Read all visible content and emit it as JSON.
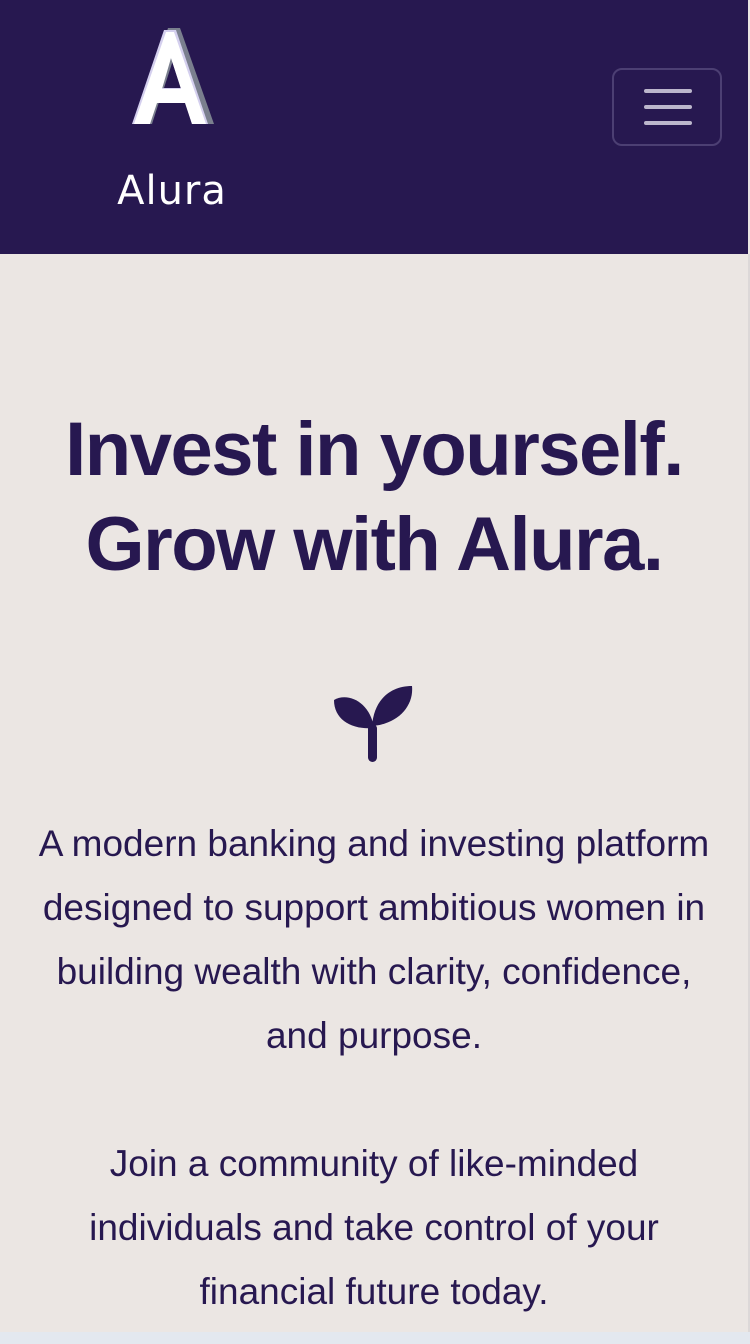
{
  "header": {
    "logo_text": "Alura",
    "menu_icon": "hamburger-icon"
  },
  "hero": {
    "title_line1": "Invest in yourself.",
    "title_line2": "Grow with Alura.",
    "icon": "sprout-icon",
    "paragraph1": "A modern banking and investing platform designed to support ambitious women in building wealth with clarity, confidence, and purpose.",
    "paragraph2": "Join a community of like-minded individuals and take control of your financial future today."
  },
  "colors": {
    "brand_navy": "#271850",
    "background": "#ebe6e3",
    "logo_lavender": "#d4cfee"
  }
}
